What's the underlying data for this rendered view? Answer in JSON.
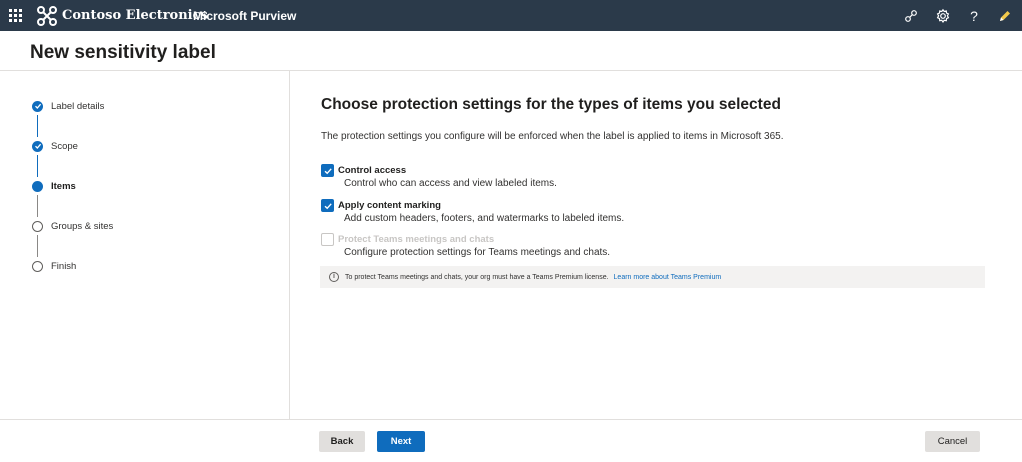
{
  "topbar": {
    "org_name": "Contoso Electronics",
    "app_name": "Microsoft Purview",
    "help_glyph": "?",
    "icons": [
      "app-launcher-icon",
      "contoso-logo-icon",
      "connections-icon",
      "settings-gear-icon",
      "help-icon",
      "pen-feedback-icon"
    ],
    "background": "#2b3a4a"
  },
  "page": {
    "title": "New sensitivity label"
  },
  "steps": [
    {
      "label": "Label details",
      "state": "done"
    },
    {
      "label": "Scope",
      "state": "done"
    },
    {
      "label": "Items",
      "state": "current"
    },
    {
      "label": "Groups & sites",
      "state": "todo"
    },
    {
      "label": "Finish",
      "state": "todo"
    }
  ],
  "main": {
    "heading": "Choose protection settings for the types of items you selected",
    "description": "The protection settings you configure will be enforced when the label is applied to items in Microsoft 365.",
    "options": [
      {
        "title": "Control access",
        "description": "Control who can access and view labeled items.",
        "checked": true,
        "disabled": false
      },
      {
        "title": "Apply content marking",
        "description": "Add custom headers, footers, and watermarks to labeled items.",
        "checked": true,
        "disabled": false
      },
      {
        "title": "Protect Teams meetings and chats",
        "description": "Configure protection settings for Teams meetings and chats.",
        "checked": false,
        "disabled": true
      }
    ],
    "info": {
      "glyph": "i",
      "text": "To protect Teams meetings and chats, your org must have a Teams Premium license.",
      "link": "Learn more about Teams Premium"
    }
  },
  "footer": {
    "back_label": "Back",
    "next_label": "Next",
    "cancel_label": "Cancel"
  },
  "colors": {
    "accent": "#0f6cbd",
    "neutral_button": "#e1dfdd"
  }
}
